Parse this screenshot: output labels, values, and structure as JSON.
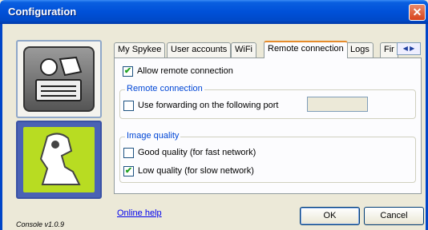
{
  "window": {
    "title": "Configuration",
    "close_symbol": "✕"
  },
  "sidebar": {
    "version": "Console v1.0.9"
  },
  "tabs": [
    {
      "label": "My Spykee"
    },
    {
      "label": "User accounts"
    },
    {
      "label": "WiFi"
    },
    {
      "label": "Remote connection",
      "active": true
    },
    {
      "label": "Logs"
    },
    {
      "label": "Fir"
    }
  ],
  "tab_scroll": {
    "left": "◀",
    "right": "▶"
  },
  "remote_tab": {
    "allow_remote": {
      "label": "Allow remote connection",
      "checked": true,
      "mark": "✔"
    },
    "remote_group": {
      "title": "Remote connection",
      "use_forwarding": {
        "label": "Use forwarding on the following port",
        "checked": false
      },
      "port_value": ""
    },
    "quality_group": {
      "title": "Image quality",
      "good": {
        "label": "Good quality (for fast network)",
        "checked": false
      },
      "low": {
        "label": "Low quality (for slow network)",
        "checked": true,
        "mark": "✔"
      }
    }
  },
  "footer": {
    "help_link": "Online help",
    "ok_label": "OK",
    "cancel_label": "Cancel"
  },
  "colors": {
    "title_bar": "#0050d8",
    "group_title": "#0046d5",
    "spykee_green": "#b8dc22",
    "active_tab_accent": "#e68b2c"
  }
}
